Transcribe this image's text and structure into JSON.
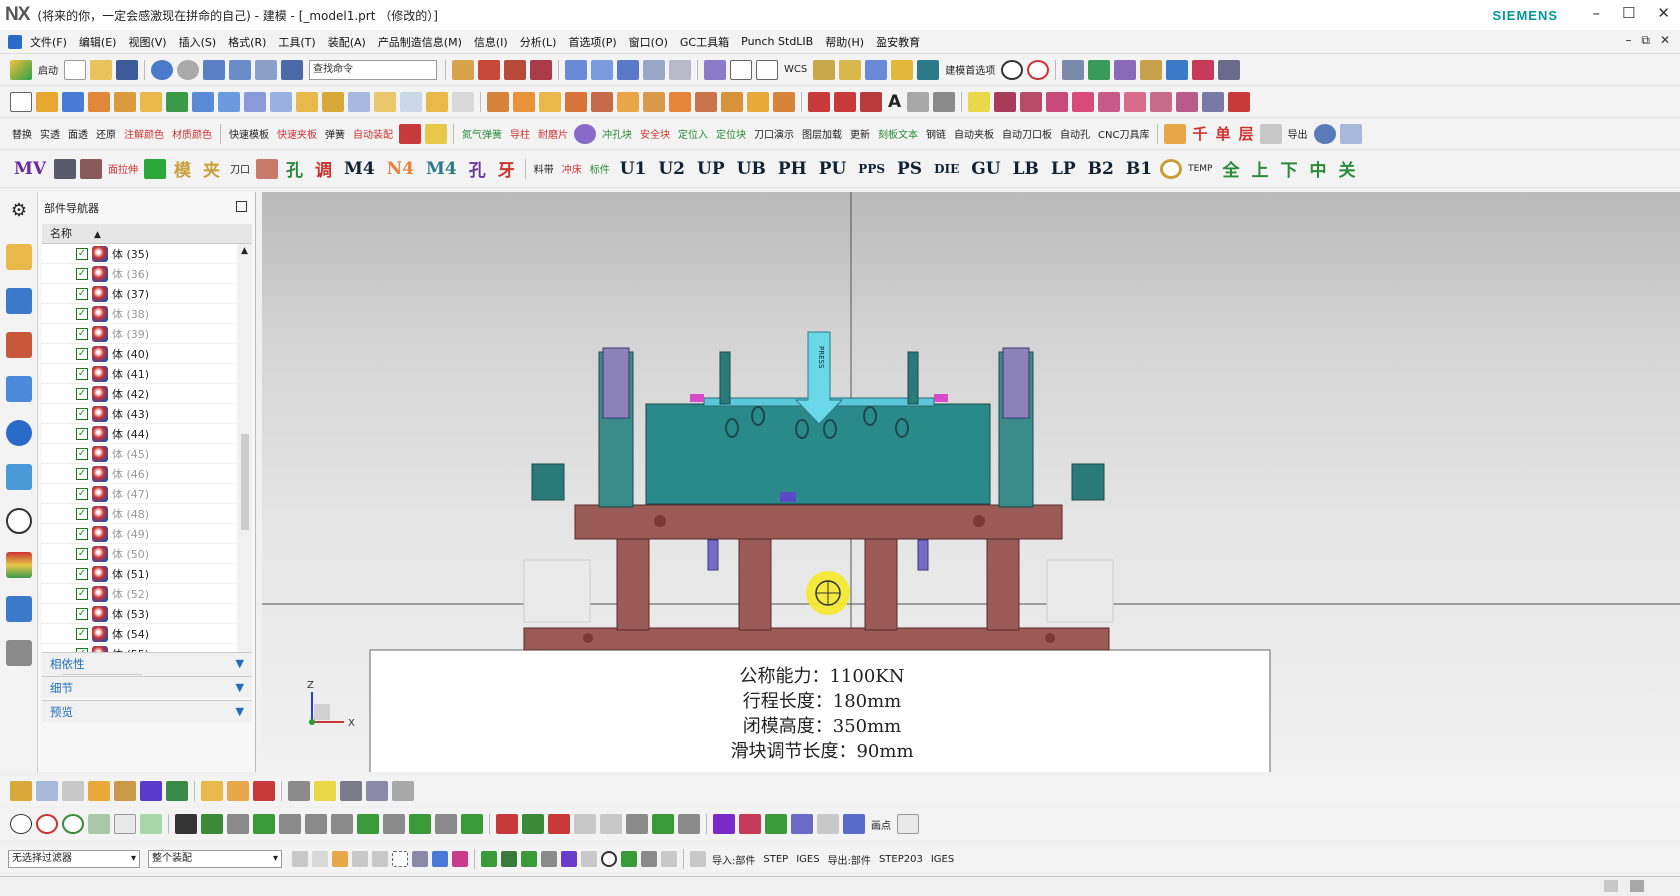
{
  "window": {
    "logo": "NX",
    "title": "(将来的你，一定会感激现在拼命的自己) - 建模 - [_model1.prt （修改的）]",
    "brand": "SIEMENS",
    "min": "–",
    "max": "☐",
    "close": "✕"
  },
  "menu": [
    "文件(F)",
    "编辑(E)",
    "视图(V)",
    "插入(S)",
    "格式(R)",
    "工具(T)",
    "装配(A)",
    "产品制造信息(M)",
    "信息(I)",
    "分析(L)",
    "首选项(P)",
    "窗口(O)",
    "GC工具箱",
    "Punch StdLIB",
    "帮助(H)",
    "盈安教育"
  ],
  "menu_right": [
    "–",
    "⧉",
    "✕"
  ],
  "toolbar1": {
    "start": "启动",
    "search_placeholder": "查找命令",
    "wcs": "WCS",
    "pref": "建模首选项"
  },
  "toolbar3": [
    "替换",
    "实透",
    "面透",
    "还原",
    "注解颜色",
    "材质颜色",
    "快速模板",
    "快速夹板",
    "弹簧",
    "自动装配",
    "氮气弹簧",
    "导柱",
    "耐磨片",
    "冲孔块",
    "安全块",
    "定位入",
    "定位块",
    "刀口演示",
    "图层加载",
    "更新",
    "刻板文本",
    "钢链",
    "自动夹板",
    "自动刀口板",
    "自动孔",
    "CNC刀具库",
    "千",
    "单",
    "层",
    "导出"
  ],
  "toolbar4": [
    "MV",
    "面拉伸",
    "模",
    "夹",
    "刀口",
    "孔",
    "调",
    "M4",
    "N4",
    "M4",
    "孔",
    "牙",
    "料带",
    "冲床",
    "标件",
    "U1",
    "U2",
    "UP",
    "UB",
    "PH",
    "PU",
    "PPS",
    "PS",
    "DIE",
    "GU",
    "LB",
    "LP",
    "B2",
    "B1",
    "TEMP",
    "全",
    "上",
    "下",
    "中",
    "关"
  ],
  "navigator": {
    "title": "部件导航器",
    "column": "名称",
    "items": [
      {
        "label": "体 (35)",
        "dim": false
      },
      {
        "label": "体 (36)",
        "dim": true
      },
      {
        "label": "体 (37)",
        "dim": false
      },
      {
        "label": "体 (38)",
        "dim": true
      },
      {
        "label": "体 (39)",
        "dim": true
      },
      {
        "label": "体 (40)",
        "dim": false
      },
      {
        "label": "体 (41)",
        "dim": false
      },
      {
        "label": "体 (42)",
        "dim": false
      },
      {
        "label": "体 (43)",
        "dim": false
      },
      {
        "label": "体 (44)",
        "dim": false
      },
      {
        "label": "体 (45)",
        "dim": true
      },
      {
        "label": "体 (46)",
        "dim": true
      },
      {
        "label": "体 (47)",
        "dim": true
      },
      {
        "label": "体 (48)",
        "dim": true
      },
      {
        "label": "体 (49)",
        "dim": true
      },
      {
        "label": "体 (50)",
        "dim": true
      },
      {
        "label": "体 (51)",
        "dim": false
      },
      {
        "label": "体 (52)",
        "dim": true
      },
      {
        "label": "体 (53)",
        "dim": false
      },
      {
        "label": "体 (54)",
        "dim": false
      },
      {
        "label": "体 (55)",
        "dim": false
      },
      {
        "label": "体 (56)",
        "dim": true
      }
    ],
    "sections": [
      "相依性",
      "细节",
      "预览"
    ]
  },
  "viewport": {
    "press_label": "PRESS",
    "spec_lines": [
      "公称能力：1100KN",
      "行程长度：180mm",
      "闭模高度：350mm",
      "滑块调节长度：90mm"
    ],
    "axis_z": "Z",
    "axis_x": "X"
  },
  "bottom": {
    "filter": "无选择过滤器",
    "assembly": "整个装配",
    "ref_point": "画点",
    "import_label": "导入:部件",
    "step": "STEP",
    "iges": "IGES",
    "export_label": "导出:部件",
    "step203": "STEP203",
    "iges2": "IGES"
  }
}
